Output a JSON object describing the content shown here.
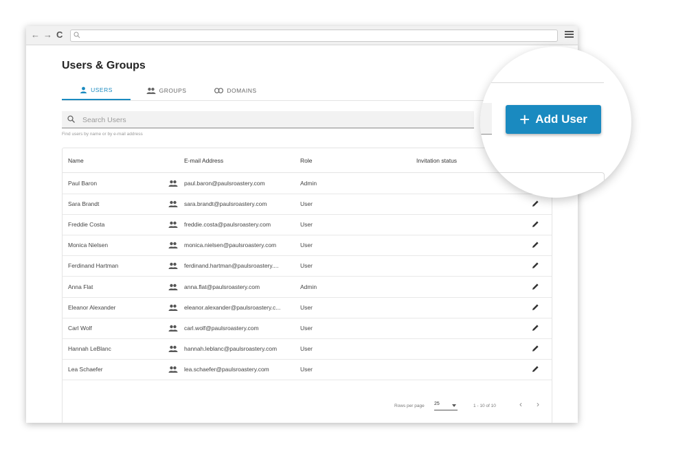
{
  "browser": {
    "url": ""
  },
  "page": {
    "title": "Users & Groups"
  },
  "tabs": [
    {
      "label": "USERS",
      "icon": "person-icon",
      "active": true
    },
    {
      "label": "GROUPS",
      "icon": "group-icon",
      "active": false
    },
    {
      "label": "DOMAINS",
      "icon": "link-icon",
      "active": false
    }
  ],
  "search": {
    "placeholder": "Search Users",
    "hint": "Find users by name or by e-mail address"
  },
  "table": {
    "headers": {
      "name": "Name",
      "email": "E-mail Address",
      "role": "Role",
      "invitation": "Invitation status"
    },
    "rows": [
      {
        "name": "Paul Baron",
        "email": "paul.baron@paulsroastery.com",
        "role": "Admin"
      },
      {
        "name": "Sara Brandt",
        "email": "sara.brandt@paulsroastery.com",
        "role": "User"
      },
      {
        "name": "Freddie Costa",
        "email": "freddie.costa@paulsroastery.com",
        "role": "User"
      },
      {
        "name": "Monica Nielsen",
        "email": "monica.nielsen@paulsroastery.com",
        "role": "User"
      },
      {
        "name": "Ferdinand Hartman",
        "email": "ferdinand.hartman@paulsroastery....",
        "role": "User"
      },
      {
        "name": "Anna Flat",
        "email": "anna.flat@paulsroastery.com",
        "role": "Admin"
      },
      {
        "name": "Eleanor Alexander",
        "email": "eleanor.alexander@paulsroastery.c...",
        "role": "User"
      },
      {
        "name": "Carl Wolf",
        "email": "carl.wolf@paulsroastery.com",
        "role": "User"
      },
      {
        "name": "Hannah LeBlanc",
        "email": "hannah.leblanc@paulsroastery.com",
        "role": "User"
      },
      {
        "name": "Lea Schaefer",
        "email": "lea.schaefer@paulsroastery.com",
        "role": "User"
      }
    ]
  },
  "pagination": {
    "rows_per_page_label": "Rows per page",
    "rows_per_page": "25",
    "range": "1 - 10 of 10",
    "prev": "‹",
    "next": "›"
  },
  "add_user": {
    "label": "Add User",
    "plus": "+"
  },
  "colors": {
    "accent": "#1a8ac0"
  }
}
